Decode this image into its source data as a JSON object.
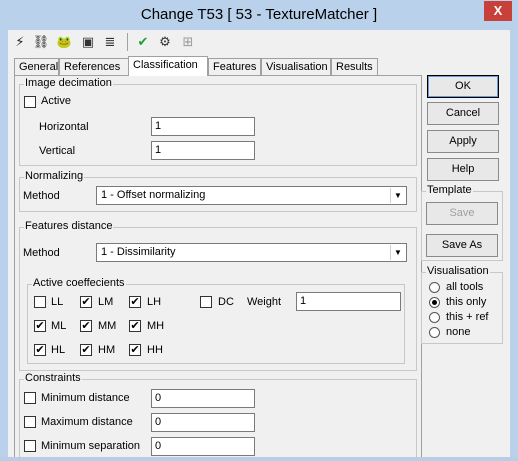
{
  "window": {
    "title": "Change T53 [ 53 - TextureMatcher ]",
    "close_glyph": "X"
  },
  "toolbar": {
    "icons": [
      {
        "name": "lightning-icon",
        "glyph": "⚡"
      },
      {
        "name": "link-icon",
        "glyph": "⛓"
      },
      {
        "name": "frog-icon",
        "glyph": "🐸"
      },
      {
        "name": "console-icon",
        "glyph": "▣"
      },
      {
        "name": "notes-icon",
        "glyph": "≣"
      },
      {
        "name": "check-icon",
        "glyph": "✔"
      },
      {
        "name": "tool-icon",
        "glyph": "⚙"
      },
      {
        "name": "network-icon",
        "glyph": "⊞"
      }
    ]
  },
  "tabs": [
    "General",
    "References",
    "Classification",
    "Features",
    "Visualisation",
    "Results"
  ],
  "active_tab": "Classification",
  "image_decimation": {
    "title": "Image decimation",
    "active_label": "Active",
    "horizontal_label": "Horizontal",
    "horizontal_value": "1",
    "vertical_label": "Vertical",
    "vertical_value": "1"
  },
  "normalizing": {
    "title": "Normalizing",
    "method_label": "Method",
    "method_value": "1 - Offset normalizing"
  },
  "features_distance": {
    "title": "Features distance",
    "method_label": "Method",
    "method_value": "1 - Dissimilarity",
    "coeffs_title": "Active coeffecients",
    "coeffs": [
      {
        "label": "LL",
        "checked": false
      },
      {
        "label": "LM",
        "checked": true
      },
      {
        "label": "LH",
        "checked": true
      },
      {
        "label": "ML",
        "checked": true
      },
      {
        "label": "MM",
        "checked": true
      },
      {
        "label": "MH",
        "checked": true
      },
      {
        "label": "HL",
        "checked": true
      },
      {
        "label": "HM",
        "checked": true
      },
      {
        "label": "HH",
        "checked": true
      }
    ],
    "dc_label": "DC",
    "dc_checked": false,
    "weight_label": "Weight",
    "weight_value": "1"
  },
  "constraints": {
    "title": "Constraints",
    "items": [
      {
        "label": "Minimum distance",
        "value": "0"
      },
      {
        "label": "Maximum distance",
        "value": "0"
      },
      {
        "label": "Minimum separation",
        "value": "0"
      }
    ]
  },
  "buttons": {
    "ok": "OK",
    "cancel": "Cancel",
    "apply": "Apply",
    "help": "Help"
  },
  "template": {
    "title": "Template",
    "save": "Save",
    "save_as": "Save As"
  },
  "visualisation": {
    "title": "Visualisation",
    "options": [
      "all tools",
      "this only",
      "this + ref",
      "none"
    ],
    "selected": "this only"
  },
  "check_glyph": "✔"
}
